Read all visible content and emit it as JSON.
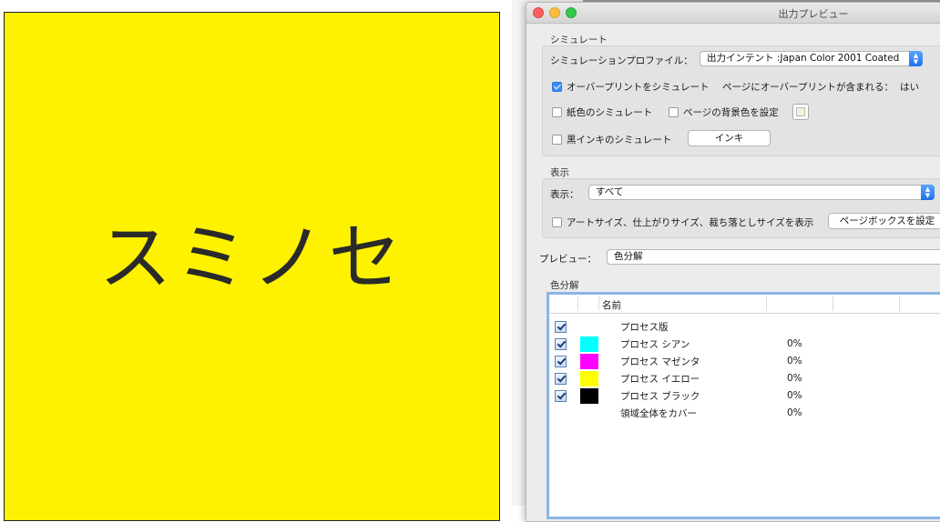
{
  "document": {
    "text": "スミノセ",
    "background": "#FFF200"
  },
  "window": {
    "title": "出力プレビュー"
  },
  "simulation": {
    "section_label": "シミュレート",
    "profile_label": "シミュレーションプロファイル：",
    "profile_value": "出力インテント :Japan Color 2001 Coated",
    "overprint_label": "オーバープリントをシミュレート",
    "overprint_checked": true,
    "overprint_contains_label": "ページにオーバープリントが含まれる：",
    "overprint_contains_value": "はい",
    "paper_color_label": "紙色のシミュレート",
    "page_bg_label": "ページの背景色を設定",
    "black_ink_label": "黒インキのシミュレート",
    "ink_button": "インキ"
  },
  "display": {
    "section_label": "表示",
    "show_label": "表示：",
    "show_value": "すべて",
    "artsize_label": "アートサイズ、仕上がりサイズ、裁ち落としサイズを表示",
    "pagebox_button": "ページボックスを設定"
  },
  "preview": {
    "label": "プレビュー：",
    "value": "色分解"
  },
  "separations": {
    "section_label": "色分解",
    "col_name": "名前",
    "rows": [
      {
        "name": "プロセス版",
        "percent": "",
        "color": "",
        "checked": true
      },
      {
        "name": "プロセス シアン",
        "percent": "0%",
        "color": "#00FFFF",
        "checked": true
      },
      {
        "name": "プロセス マゼンタ",
        "percent": "0%",
        "color": "#FF00FF",
        "checked": true
      },
      {
        "name": "プロセス イエロー",
        "percent": "0%",
        "color": "#FFFF00",
        "checked": true
      },
      {
        "name": "プロセス ブラック",
        "percent": "0%",
        "color": "#000000",
        "checked": true
      },
      {
        "name": "領域全体をカバー",
        "percent": "0%",
        "color": "",
        "checked": false
      }
    ]
  }
}
